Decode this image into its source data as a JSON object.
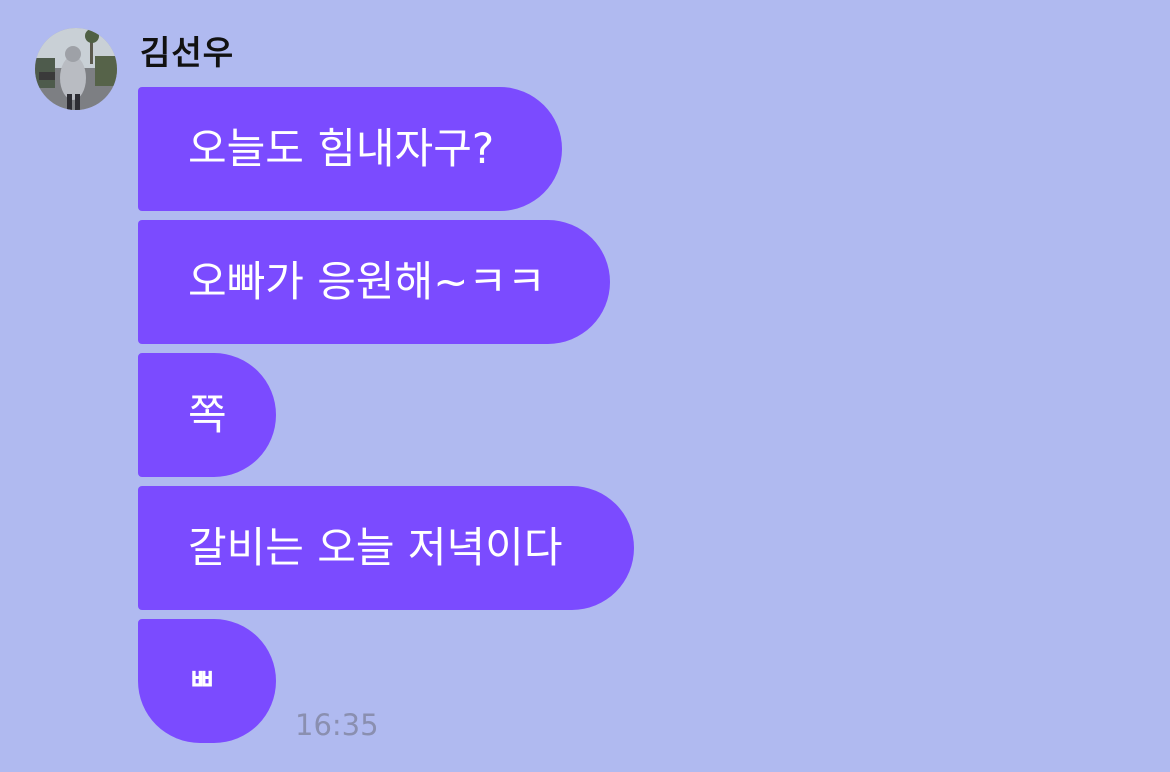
{
  "chat": {
    "sender_name": "김선우",
    "messages": [
      {
        "text": "오늘도 힘내자구?"
      },
      {
        "text": "오빠가 응원해~ㅋㅋ"
      },
      {
        "text": "쪽"
      },
      {
        "text": "갈비는 오늘 저녁이다"
      },
      {
        "text": "ㅃ"
      }
    ],
    "timestamp": "16:35"
  },
  "colors": {
    "background": "#b0baf0",
    "bubble": "#7b4bff",
    "bubble_text": "#ffffff",
    "timestamp": "#8a8fb0"
  },
  "icons": {
    "avatar": "profile-photo"
  }
}
